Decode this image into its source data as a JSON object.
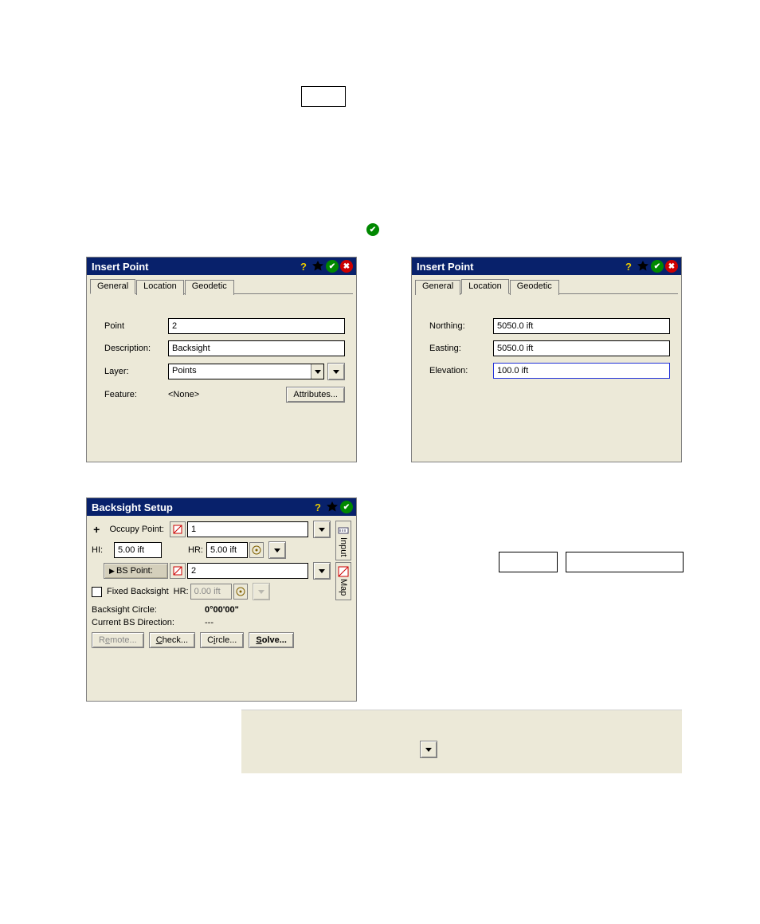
{
  "top_empty_box": {},
  "dialog1": {
    "title": "Insert Point",
    "tabs": {
      "general": "General",
      "location": "Location",
      "geodetic": "Geodetic",
      "active": "general"
    },
    "fields": {
      "point_label": "Point",
      "point_value": "2",
      "description_label": "Description:",
      "description_value": "Backsight",
      "layer_label": "Layer:",
      "layer_value": "Points",
      "feature_label": "Feature:",
      "feature_value": "<None>",
      "attributes_btn": "Attributes..."
    }
  },
  "dialog2": {
    "title": "Insert Point",
    "tabs": {
      "general": "General",
      "location": "Location",
      "geodetic": "Geodetic",
      "active": "location"
    },
    "fields": {
      "northing_label": "Northing:",
      "northing_value": "5050.0 ift",
      "easting_label": "Easting:",
      "easting_value": "5050.0 ift",
      "elevation_label": "Elevation:",
      "elevation_value": "100.0 ift"
    }
  },
  "dialog3": {
    "title": "Backsight Setup",
    "occupy_label": "Occupy Point:",
    "occupy_value": "1",
    "hi_label": "HI:",
    "hi_value": "5.00 ift",
    "hr_label": "HR:",
    "hr_value": "5.00 ift",
    "bs_point_label": "BS Point:",
    "bs_point_value": "2",
    "fixed_bs_label": "Fixed Backsight",
    "fixed_hr_label": "HR:",
    "fixed_hr_value": "0.00 ift",
    "circle_label": "Backsight Circle:",
    "circle_value": "0°00'00\"",
    "direction_label": "Current BS Direction:",
    "direction_value": "---",
    "buttons": {
      "remote": "Remote...",
      "check": "Check...",
      "circle": "Circle...",
      "solve": "Solve..."
    },
    "side_tabs": {
      "input": "Input",
      "map": "Map"
    }
  },
  "mid_boxes": {}
}
